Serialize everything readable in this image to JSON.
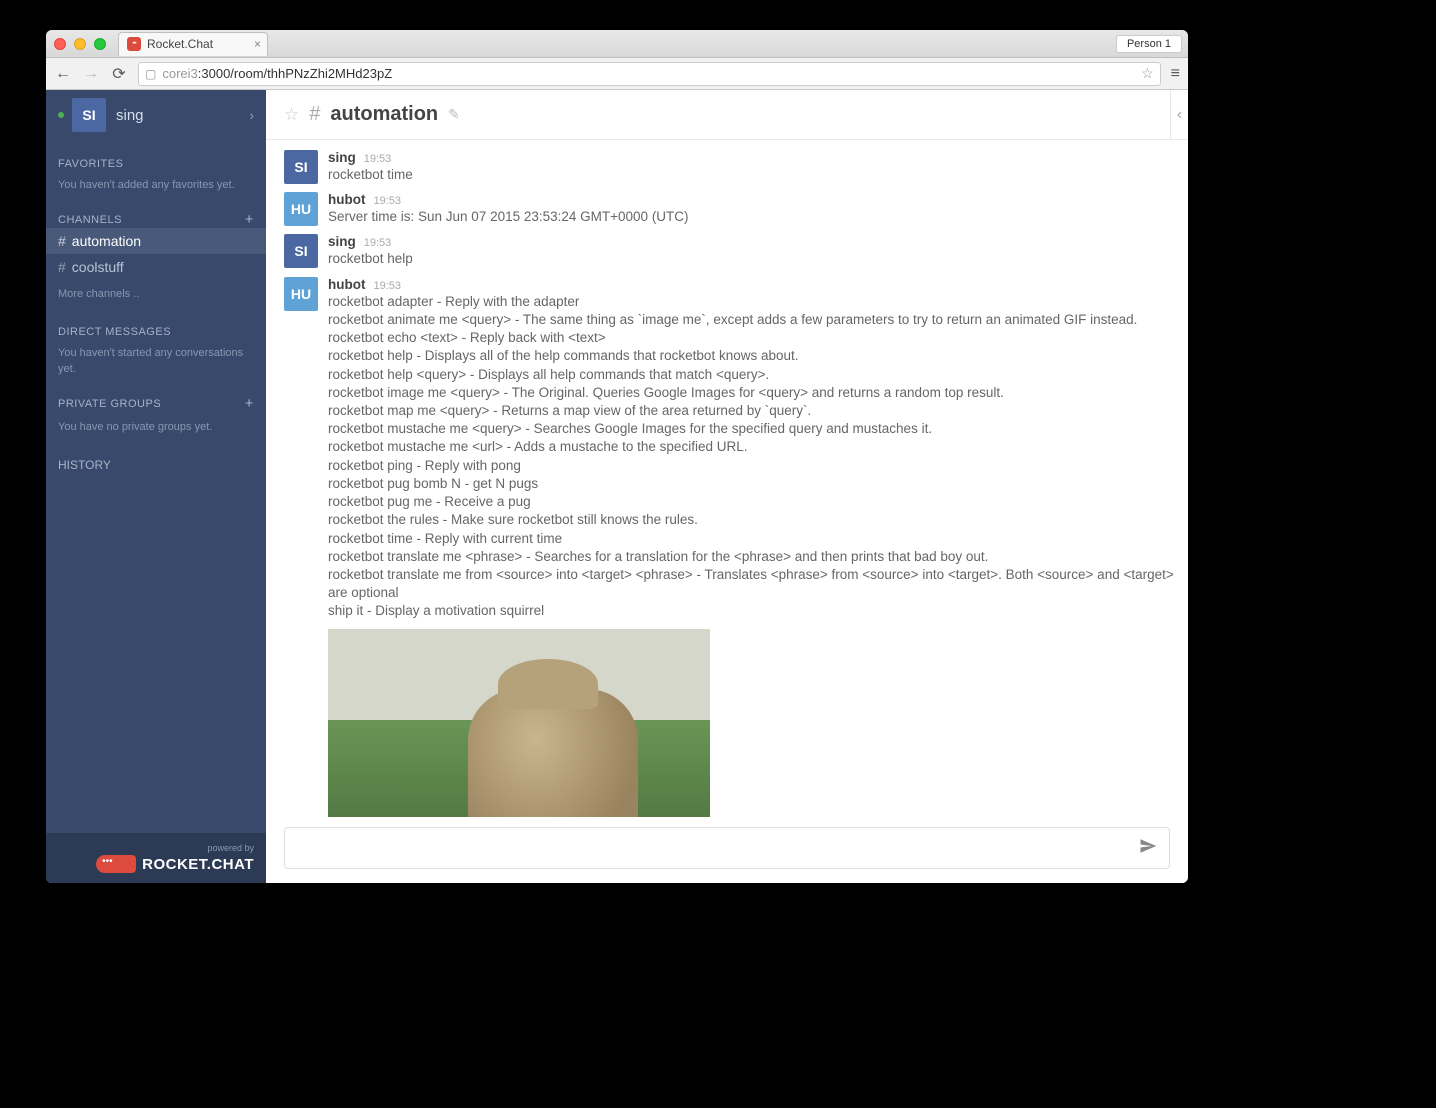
{
  "browser": {
    "tab_title": "Rocket.Chat",
    "profile_label": "Person 1",
    "url_host_dim": "corei3",
    "url_path": ":3000/room/thhPNzZhi2MHd23pZ"
  },
  "sidebar": {
    "user": {
      "initials": "SI",
      "name": "sing"
    },
    "favorites": {
      "label": "FAVORITES",
      "hint": "You haven't added any favorites yet."
    },
    "channels": {
      "label": "CHANNELS",
      "items": [
        {
          "name": "automation",
          "active": true
        },
        {
          "name": "coolstuff",
          "active": false
        }
      ],
      "more": "More channels .."
    },
    "direct_messages": {
      "label": "DIRECT MESSAGES",
      "hint": "You haven't started any conversations yet."
    },
    "private_groups": {
      "label": "PRIVATE GROUPS",
      "hint": "You have no private groups yet."
    },
    "history_label": "HISTORY",
    "footer": {
      "powered_by": "powered by",
      "brand": "ROCKET.CHAT"
    }
  },
  "header": {
    "channel_name": "automation"
  },
  "messages": [
    {
      "avatar_initials": "SI",
      "avatar_class": "av-si",
      "user": "sing",
      "time": "19:53",
      "lines": [
        "rocketbot time"
      ]
    },
    {
      "avatar_initials": "HU",
      "avatar_class": "av-hu",
      "user": "hubot",
      "time": "19:53",
      "lines": [
        "Server time is: Sun Jun 07 2015 23:53:24 GMT+0000 (UTC)"
      ]
    },
    {
      "avatar_initials": "SI",
      "avatar_class": "av-si",
      "user": "sing",
      "time": "19:53",
      "lines": [
        "rocketbot help"
      ]
    },
    {
      "avatar_initials": "HU",
      "avatar_class": "av-hu",
      "user": "hubot",
      "time": "19:53",
      "lines": [
        "rocketbot adapter - Reply with the adapter",
        "rocketbot animate me <query> - The same thing as `image me`, except adds a few parameters to try to return an animated GIF instead.",
        "rocketbot echo <text> - Reply back with <text>",
        "rocketbot help - Displays all of the help commands that rocketbot knows about.",
        "rocketbot help <query> - Displays all help commands that match <query>.",
        "rocketbot image me <query> - The Original. Queries Google Images for <query> and returns a random top result.",
        "rocketbot map me <query> - Returns a map view of the area returned by `query`.",
        "rocketbot mustache me <query> - Searches Google Images for the specified query and mustaches it.",
        "rocketbot mustache me <url> - Adds a mustache to the specified URL.",
        "rocketbot ping - Reply with pong",
        "rocketbot pug bomb N - get N pugs",
        "rocketbot pug me - Receive a pug",
        "rocketbot the rules - Make sure rocketbot still knows the rules.",
        "rocketbot time - Reply with current time",
        "rocketbot translate me <phrase> - Searches for a translation for the <phrase> and then prints that bad boy out.",
        "rocketbot translate me from <source> into <target> <phrase> - Translates <phrase> from <source> into <target>. Both <source> and <target> are optional",
        "ship it - Display a motivation squirrel"
      ],
      "has_image": true
    }
  ],
  "composer": {
    "placeholder": ""
  }
}
